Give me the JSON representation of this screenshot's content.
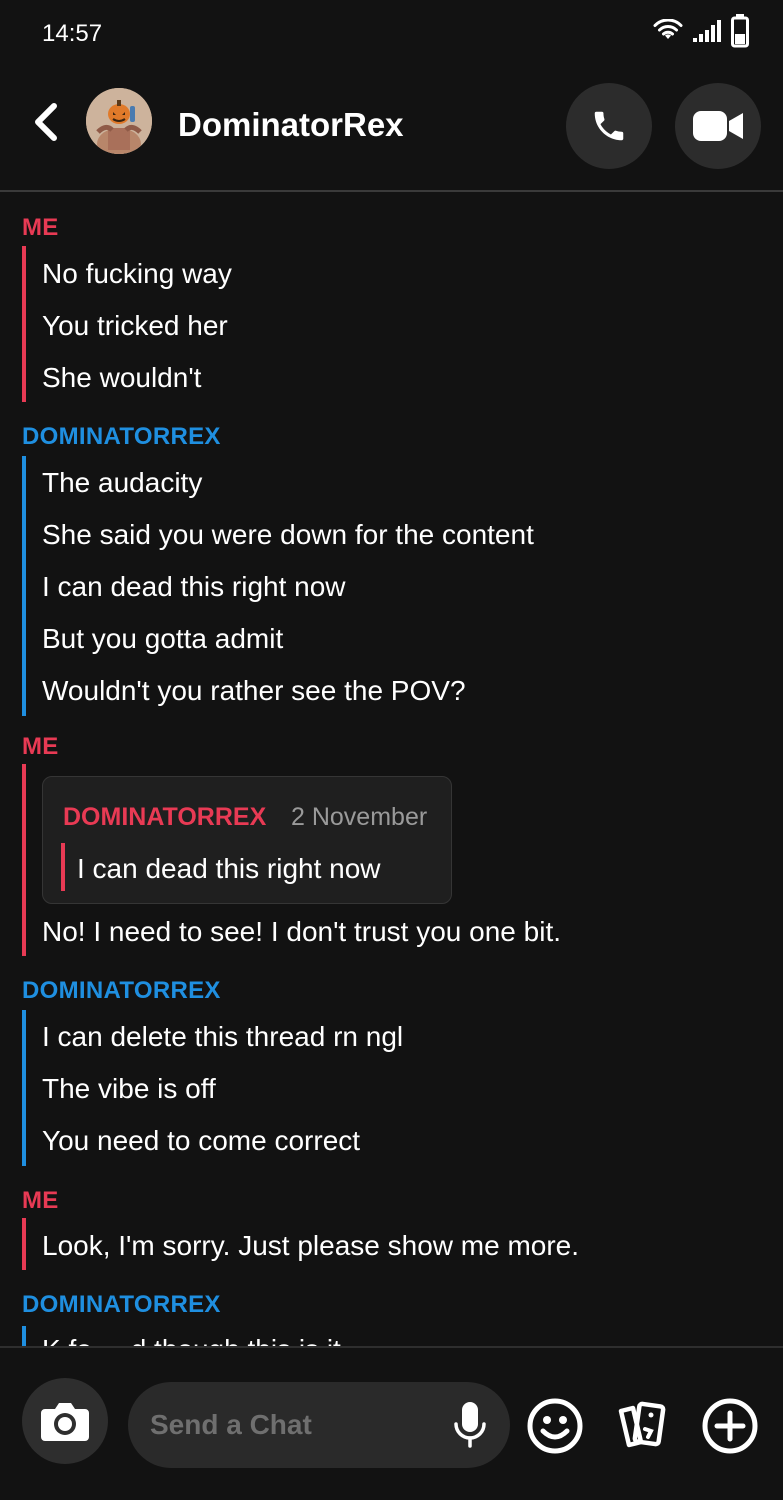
{
  "status_bar": {
    "time": "14:57",
    "icons": [
      "wifi-icon",
      "signal-icon",
      "battery-icon"
    ]
  },
  "header": {
    "contact_name": "DominatorRex",
    "icons": [
      "back-chevron-icon",
      "phone-icon",
      "video-camera-icon"
    ]
  },
  "colors": {
    "me": "#e83a54",
    "other": "#1f8fe0",
    "background": "#121212"
  },
  "conversation": [
    {
      "sender": "ME",
      "messages": [
        "No fucking way",
        "You tricked her",
        "She wouldn't"
      ]
    },
    {
      "sender": "DOMINATORREX",
      "messages": [
        "The audacity",
        "She said you were down for the content",
        "I can dead this right now",
        "But you gotta admit",
        "Wouldn't you rather see the POV?"
      ]
    },
    {
      "sender": "ME",
      "quote": {
        "author": "DOMINATORREX",
        "date": "2 November",
        "text": "I can dead this right now"
      },
      "messages": [
        "No! I need to see! I don't trust you one bit."
      ]
    },
    {
      "sender": "DOMINATORREX",
      "messages": [
        "I can delete this thread rn ngl",
        "The vibe is off",
        "You need to come correct"
      ]
    },
    {
      "sender": "ME",
      "messages": [
        "Look, I'm sorry. Just please show me more."
      ]
    },
    {
      "sender": "DOMINATORREX",
      "messages": [
        "K fo ... d though this is it"
      ]
    }
  ],
  "composer": {
    "placeholder": "Send a Chat",
    "icons": [
      "camera-icon",
      "microphone-icon",
      "smiley-icon",
      "cards-icon",
      "plus-circle-icon"
    ]
  }
}
